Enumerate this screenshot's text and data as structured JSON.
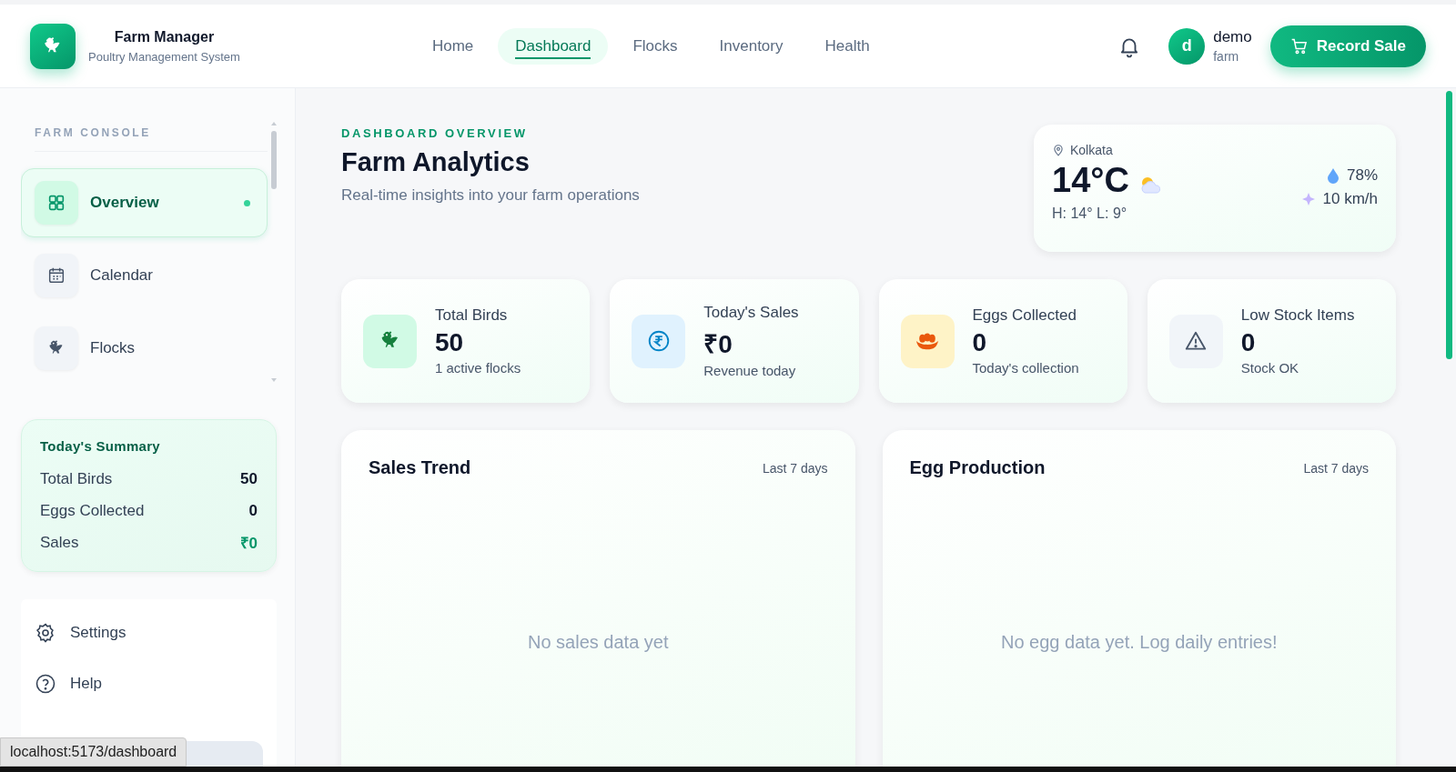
{
  "header": {
    "logo": {
      "title": "Farm Manager",
      "subtitle": "Poultry Management System"
    },
    "nav": [
      {
        "label": "Home",
        "selected": false
      },
      {
        "label": "Dashboard",
        "selected": true
      },
      {
        "label": "Flocks",
        "selected": false
      },
      {
        "label": "Inventory",
        "selected": false
      },
      {
        "label": "Health",
        "selected": false
      }
    ],
    "user": {
      "initial": "d",
      "name": "demo",
      "role": "farm"
    },
    "action_button": "Record Sale"
  },
  "sidebar": {
    "section_title": "FARM CONSOLE",
    "items": [
      {
        "label": "Overview",
        "kind": "grid",
        "selected": true
      },
      {
        "label": "Calendar",
        "kind": "calendar",
        "selected": false
      },
      {
        "label": "Flocks",
        "kind": "bird",
        "selected": false
      }
    ],
    "summary": {
      "title": "Today's Summary",
      "rows": [
        {
          "label": "Total Birds",
          "value": "50",
          "kind": "plain"
        },
        {
          "label": "Eggs Collected",
          "value": "0",
          "kind": "plain"
        },
        {
          "label": "Sales",
          "value": "₹0",
          "kind": "money"
        }
      ]
    },
    "footer_items": [
      {
        "label": "Settings",
        "kind": "gear"
      },
      {
        "label": "Help",
        "kind": "help"
      }
    ]
  },
  "main": {
    "eyebrow": "DASHBOARD OVERVIEW",
    "title": "Farm Analytics",
    "subtitle": "Real-time insights into your farm operations",
    "weather": {
      "location": "Kolkata",
      "temperature": "14°C",
      "high_low": "H: 14° L: 9°",
      "humidity": "78%",
      "wind": "10 km/h"
    },
    "stats": [
      {
        "label": "Total Birds",
        "value": "50",
        "note": "1 active flocks",
        "kind": "bird",
        "color": "#d1fae5"
      },
      {
        "label": "Today's Sales",
        "value": "₹0",
        "note": "Revenue today",
        "kind": "rupee",
        "color": "#e0f2fe"
      },
      {
        "label": "Eggs Collected",
        "value": "0",
        "note": "Today's collection",
        "kind": "eggs",
        "color": "#fef3c7"
      },
      {
        "label": "Low Stock Items",
        "value": "0",
        "note": "Stock OK",
        "kind": "warning",
        "color": "#f1f5f9"
      }
    ],
    "panels": [
      {
        "title": "Sales Trend",
        "range": "Last 7 days",
        "empty_message": "No sales data yet"
      },
      {
        "title": "Egg Production",
        "range": "Last 7 days",
        "empty_message": "No egg data yet. Log daily entries!"
      }
    ]
  },
  "status_url": "localhost:5173/dashboard"
}
